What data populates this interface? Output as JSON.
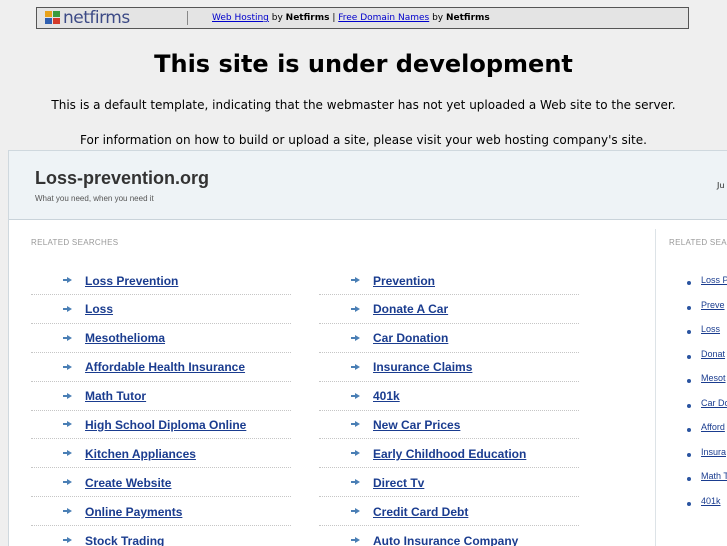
{
  "topbar": {
    "logo_text": "netfirms",
    "link1": "Web Hosting",
    "by1": " by ",
    "brand1": "Netfirms",
    "pipe": " | ",
    "link2": "Free Domain Names",
    "by2": " by ",
    "brand2": "Netfirms"
  },
  "headline": "This site is under development",
  "line1": "This is a default template, indicating that the webmaster has not yet uploaded a Web site to the server.",
  "line2": "For information on how to build or upload a site, please visit your web hosting company's site.",
  "frame": {
    "site_title": "Loss-prevention.org",
    "tagline": "What you need, when you need it",
    "date": "Ju",
    "related_label": "RELATED SEARCHES",
    "related_label_right": "RELATED SEA",
    "col_a": [
      "Loss Prevention",
      "Loss",
      "Mesothelioma",
      "Affordable Health Insurance",
      "Math Tutor",
      "High School Diploma Online",
      "Kitchen Appliances",
      "Create Website",
      "Online Payments",
      "Stock Trading"
    ],
    "col_b": [
      "Prevention",
      "Donate A Car",
      "Car Donation",
      "Insurance Claims",
      "401k",
      "New Car Prices",
      "Early Childhood Education",
      "Direct Tv",
      "Credit Card Debt",
      "Auto Insurance Company"
    ],
    "right": [
      "Loss P",
      "Preve",
      "Loss",
      "Donat",
      "Mesot",
      "Car Do",
      "Afford",
      "Insura",
      "Math T",
      "401k"
    ]
  },
  "colors": {
    "link": "#1a3c8f",
    "arrow": "#4a7fb5",
    "header_bg": "#eef3f6"
  }
}
